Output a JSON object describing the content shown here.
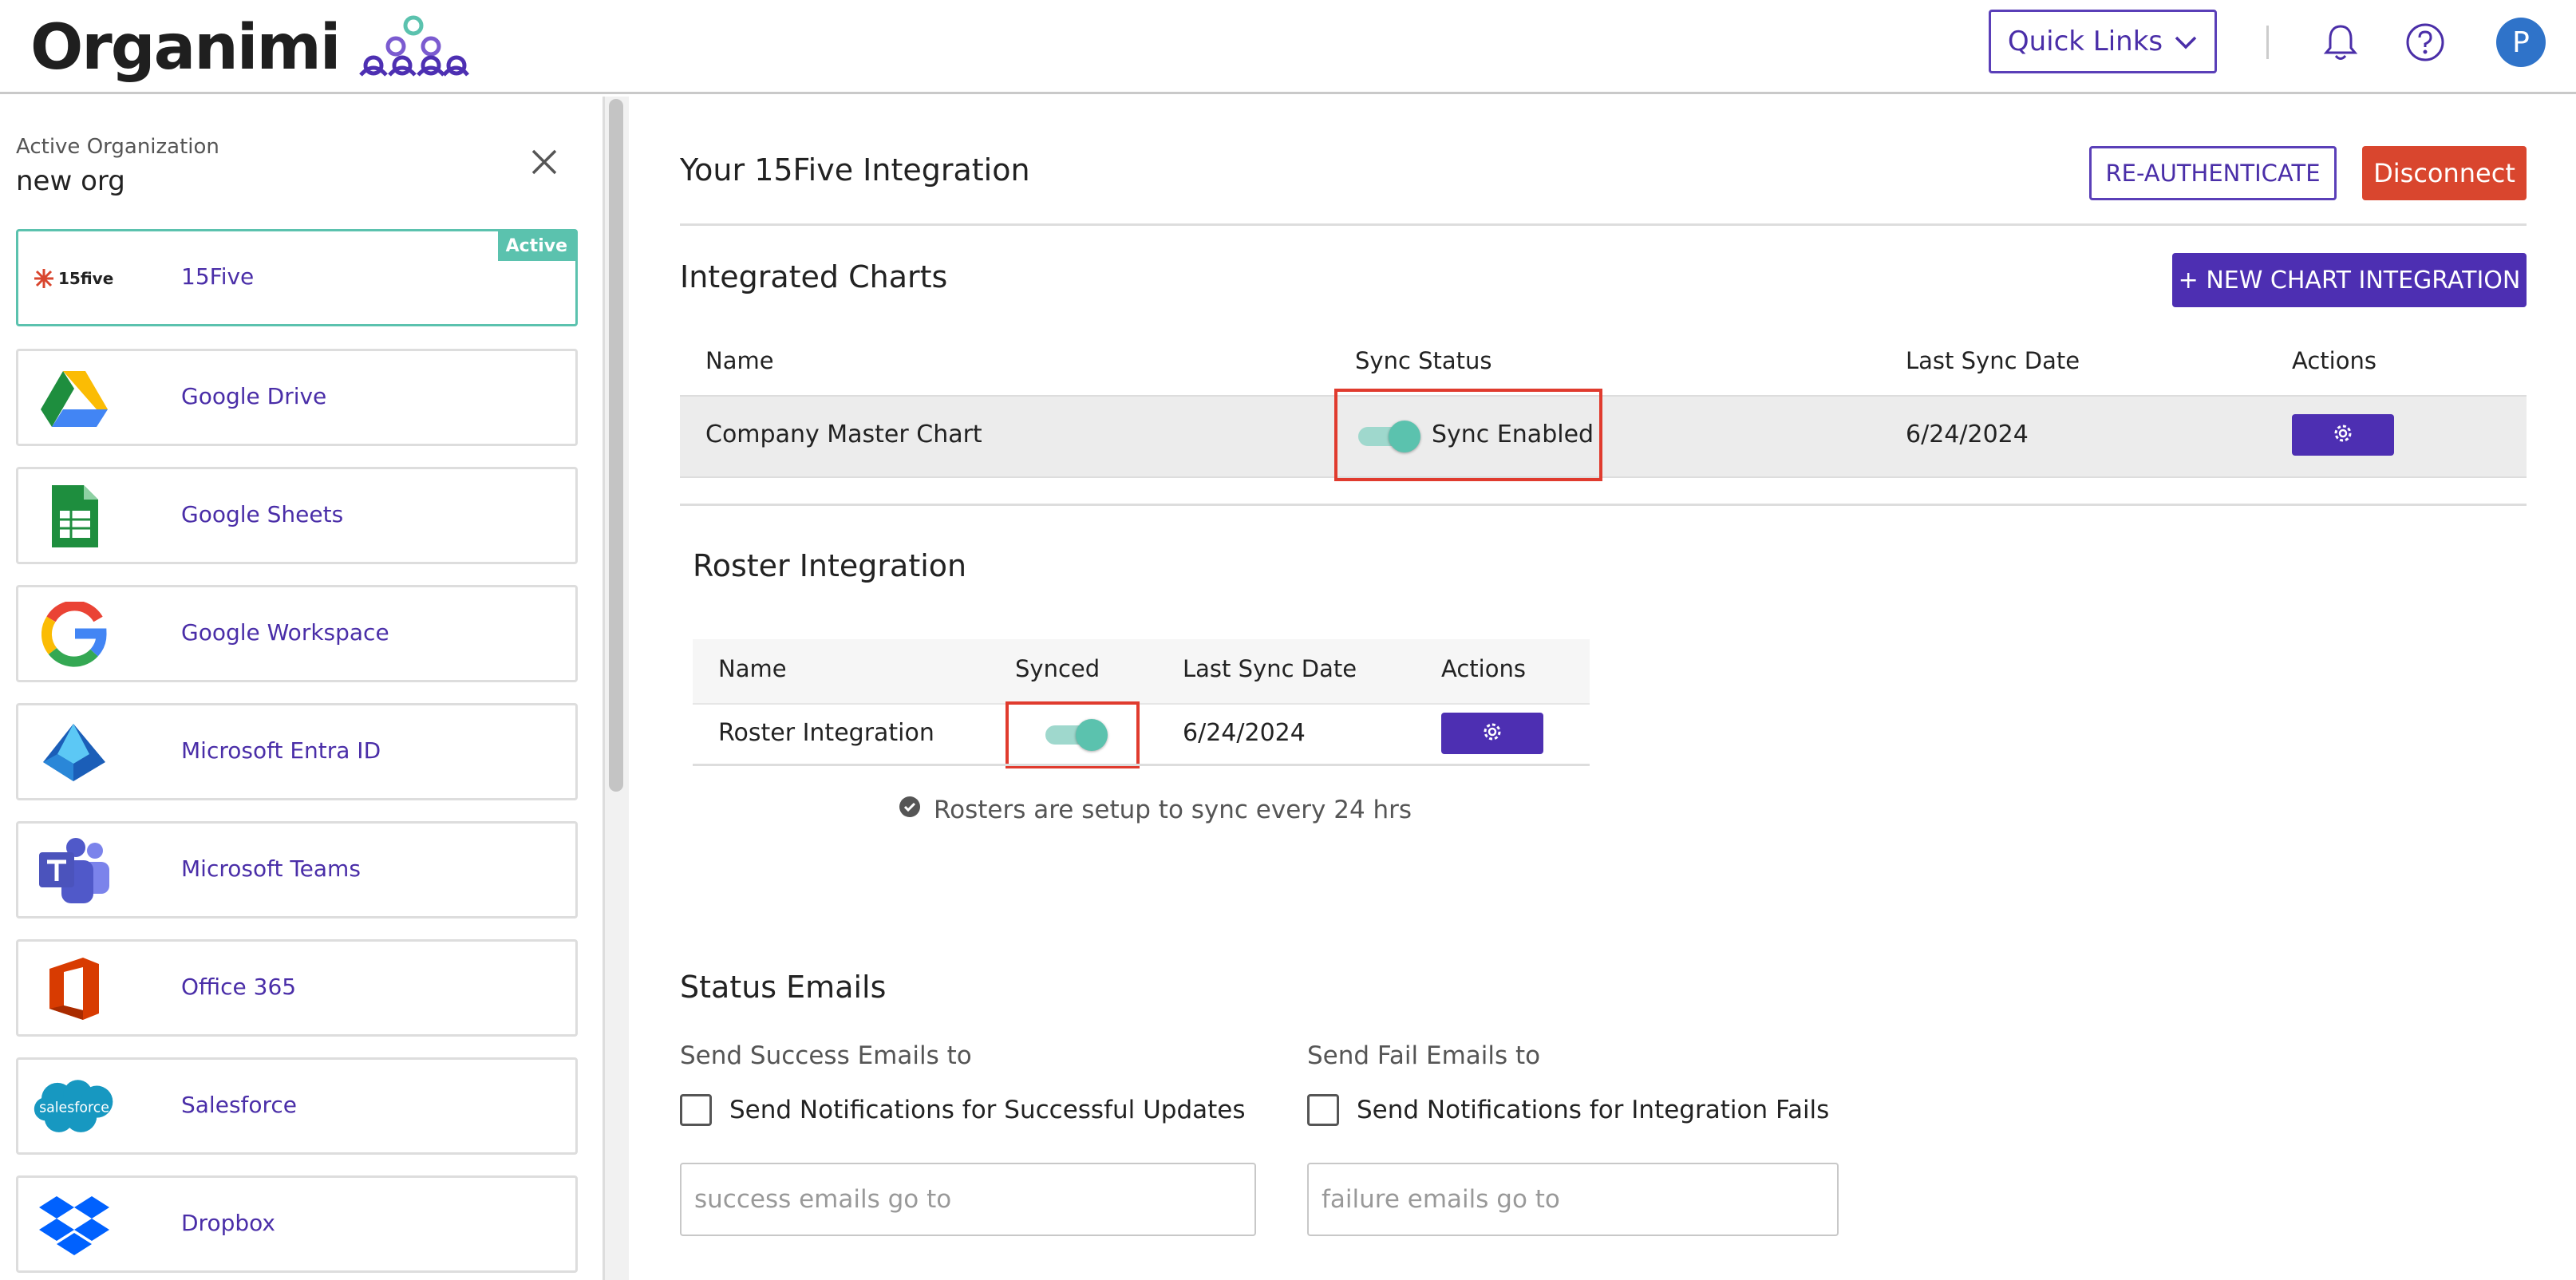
{
  "header": {
    "logo_text": "Organimi",
    "quick_links_label": "Quick Links",
    "avatar_initial": "P"
  },
  "sidebar": {
    "org_label": "Active Organization",
    "org_name": "new org",
    "active_badge": "Active",
    "items": [
      {
        "label": "15Five",
        "icon": "15five-logo-icon",
        "active": true,
        "logo_text": "15five"
      },
      {
        "label": "Google Drive",
        "icon": "google-drive-icon"
      },
      {
        "label": "Google Sheets",
        "icon": "google-sheets-icon"
      },
      {
        "label": "Google Workspace",
        "icon": "google-workspace-icon"
      },
      {
        "label": "Microsoft Entra ID",
        "icon": "microsoft-entra-icon"
      },
      {
        "label": "Microsoft Teams",
        "icon": "microsoft-teams-icon"
      },
      {
        "label": "Office 365",
        "icon": "office-365-icon"
      },
      {
        "label": "Salesforce",
        "icon": "salesforce-icon",
        "logo_text": "salesforce"
      },
      {
        "label": "Dropbox",
        "icon": "dropbox-icon"
      }
    ]
  },
  "main": {
    "title": "Your 15Five Integration",
    "reauth_label": "RE-AUTHENTICATE",
    "disconnect_label": "Disconnect",
    "integrated_charts": {
      "heading": "Integrated Charts",
      "new_button": "+ NEW CHART INTEGRATION",
      "columns": [
        "Name",
        "Sync Status",
        "Last Sync Date",
        "Actions"
      ],
      "rows": [
        {
          "name": "Company Master Chart",
          "sync_status": "Sync Enabled",
          "sync_on": true,
          "last_sync": "6/24/2024"
        }
      ]
    },
    "roster": {
      "heading": "Roster Integration",
      "columns": [
        "Name",
        "Synced",
        "Last Sync Date",
        "Actions"
      ],
      "rows": [
        {
          "name": "Roster Integration",
          "synced": true,
          "last_sync": "6/24/2024"
        }
      ],
      "note": "Rosters are setup to sync every 24 hrs"
    },
    "status_emails": {
      "heading": "Status Emails",
      "success_label": "Send Success Emails to",
      "success_checkbox": "Send Notifications for Successful Updates",
      "success_placeholder": "success emails go to",
      "fail_label": "Send Fail Emails to",
      "fail_checkbox": "Send Notifications for Integration Fails",
      "fail_placeholder": "failure emails go to"
    }
  },
  "colors": {
    "brand_purple": "#4d2fb2",
    "teal": "#5bc2ae",
    "danger": "#d9462e",
    "highlight_red": "#e03b2e"
  }
}
